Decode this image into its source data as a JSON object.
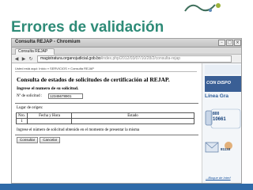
{
  "slide": {
    "title": "Errores de validación",
    "logo_text": "Ætic"
  },
  "window": {
    "title": "Consulta REJAP - Chromium",
    "tab_label": "Consulta REJAP",
    "url_host": "magistratura.organojudicial.gob.bo",
    "url_path": "/index.php/2012/03/07/10/28/2/consulta-rejap"
  },
  "page": {
    "breadcrumb": "Usted está aquí: Inicio » SERVICIOS » Consulta REJAP",
    "heading": "Consulta de estados de solicitudes de certificación al REJAP.",
    "instruction": "Ingrese el numero de su solicitud.",
    "field_label": "Nº de solicitud :",
    "field_value": "12345678901",
    "origin_label": "Lugar de origen:",
    "table": {
      "headers": [
        "Nro.",
        "Fecha y Hora",
        "Estado"
      ],
      "rows": [
        [
          "1",
          "",
          ""
        ]
      ]
    },
    "info_text": "Ingrese el número de solicitud obtenido en el momento de presentar la misma",
    "buttons": {
      "consult": "Consultar",
      "cancel": "Cancelar"
    }
  },
  "sidebar": {
    "ad_banner": "CON DISPO",
    "linea": "Línea Gra",
    "phone_label": "800",
    "phone_number": "10661",
    "ad_number": "81133",
    "footer_link": "...Bloque de Interf"
  },
  "colors": {
    "title": "#2e8b77",
    "bottom_bar": "#2f6aa8",
    "sidebar_blue": "#2f5e9a"
  }
}
